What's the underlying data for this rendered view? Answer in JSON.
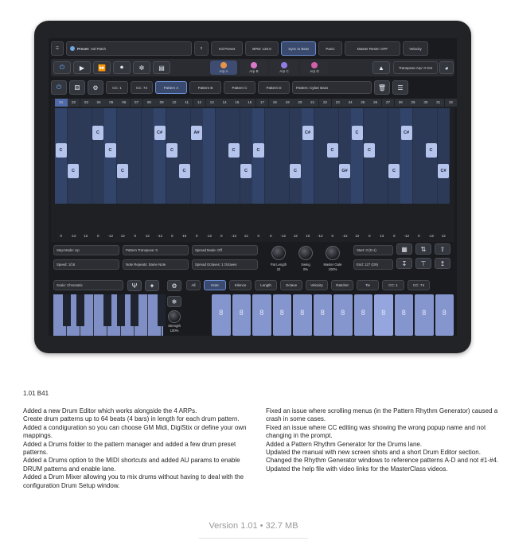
{
  "app": {
    "toolbar": {
      "preset_label": "Preset:",
      "preset_value": "Init Patch",
      "init_preset": "Init Preset",
      "bpm": "BPM: 120.0",
      "sync_to_beat": "Sync to Beat",
      "panic": "Panic",
      "master_reset": "Master Reset: OFF",
      "velocity": "Velocity"
    },
    "arp_tabs": [
      "Arp A",
      "Arp B",
      "Arp C",
      "Arp D"
    ],
    "arp_colors": [
      "#e8934a",
      "#d977c8",
      "#8f7be6",
      "#d45fa8"
    ],
    "transpose_arp": "Transpose Arp: 0 Oct",
    "pattern_bar": {
      "cc1": "CC: 1",
      "cc74": "CC: 74",
      "patterns": [
        "Pattern A",
        "Pattern B",
        "Pattern C",
        "Pattern D"
      ],
      "pattern_label": "Pattern: Cyber Bass"
    },
    "steps": [
      "01",
      "02",
      "03",
      "04",
      "05",
      "06",
      "07",
      "08",
      "09",
      "10",
      "11",
      "12",
      "13",
      "14",
      "15",
      "16",
      "17",
      "18",
      "19",
      "20",
      "21",
      "22",
      "23",
      "24",
      "25",
      "26",
      "27",
      "28",
      "29",
      "30",
      "31",
      "32"
    ],
    "step_notes": [
      "C",
      "C",
      "C",
      "C",
      "C",
      "C#",
      "C",
      "C",
      "A#",
      "C",
      "C",
      "C",
      "C",
      "C#",
      "C",
      "G#",
      "C",
      "C",
      "C",
      "C#",
      "C",
      "C#"
    ],
    "step_values": [
      "0",
      "-12",
      "12",
      "0",
      "-12",
      "12",
      "0",
      "12",
      "-12",
      "0",
      "10",
      "0",
      "-12",
      "0",
      "-12",
      "12",
      "0",
      "0",
      "-12",
      "12",
      "10",
      "-12",
      "0",
      "-12",
      "12",
      "0",
      "13",
      "0",
      "-12",
      "0",
      "-12",
      "12"
    ],
    "params": {
      "step_mode": "Step Mode: Up",
      "pattern_transpose": "Pattern Transpose: 0",
      "spread_mode": "Spread Mode: Off",
      "speed": "Speed: 1/16",
      "note_repeats": "Note Repeats: Same Note",
      "spread_octaves": "Spread Octaves: 1 Octaves",
      "pat_length_label": "Pat Length",
      "pat_length_value": "32",
      "swing_label": "Swing",
      "swing_value": "0%",
      "master_gate_label": "Master Gate",
      "master_gate_value": "100%",
      "start": "Start: 0 (D-1)",
      "end": "End: 127 (G9)"
    },
    "lower": {
      "scale": "Scale: Chromatic",
      "tabs": [
        "All",
        "Note",
        "Silence",
        "Length",
        "Octave",
        "Velocity",
        "Ratchet",
        "Tie",
        "CC: 1",
        "CC: 74"
      ],
      "strength_label": "Strength",
      "strength_value": "100%",
      "key_label": "C",
      "pad_glyph": "8",
      "pad_notes": [
        "C",
        "C#",
        "D",
        "D#",
        "E",
        "F",
        "F#",
        "G",
        "G#",
        "A",
        "A#",
        "B"
      ]
    }
  },
  "notes": {
    "version_heading": "1.01 B41",
    "left": [
      "Added a new Drum Editor which works alongside the 4 ARPs.",
      "Create drum patterns up to 64 beats (4 bars) in length for each drum pattern.",
      "Added a condiguration so you can choose GM Midi, DigiStix or define your own mappings.",
      "Added a Drums folder to the pattern manager and added a few drum preset patterns.",
      "Added a Drums option to the MIDI shortcuts and added AU params to enable DRUM patterns and enable lane.",
      "Added a Drum Mixer allowing you to mix drums without having to deal with the configuration Drum Setup window."
    ],
    "right": [
      "Fixed an issue where scrolling menus (in the Pattern Rhythm Generator) caused a crash in some cases.",
      "Fixed an issue where CC editing was showing the wrong popup name and not changing in the prompt.",
      "Added a Pattern Rhythm Generator for the Drums lane.",
      "Updated the manual with new screen shots and a short Drum Editor section.",
      "Changed the Rhythm Generator windows to reference patterns A-D and not #1-#4.",
      "Updated the help file with video links for the MasterClass videos."
    ]
  },
  "footer": {
    "version_size": "Version 1.01 • 32.7 MB"
  }
}
